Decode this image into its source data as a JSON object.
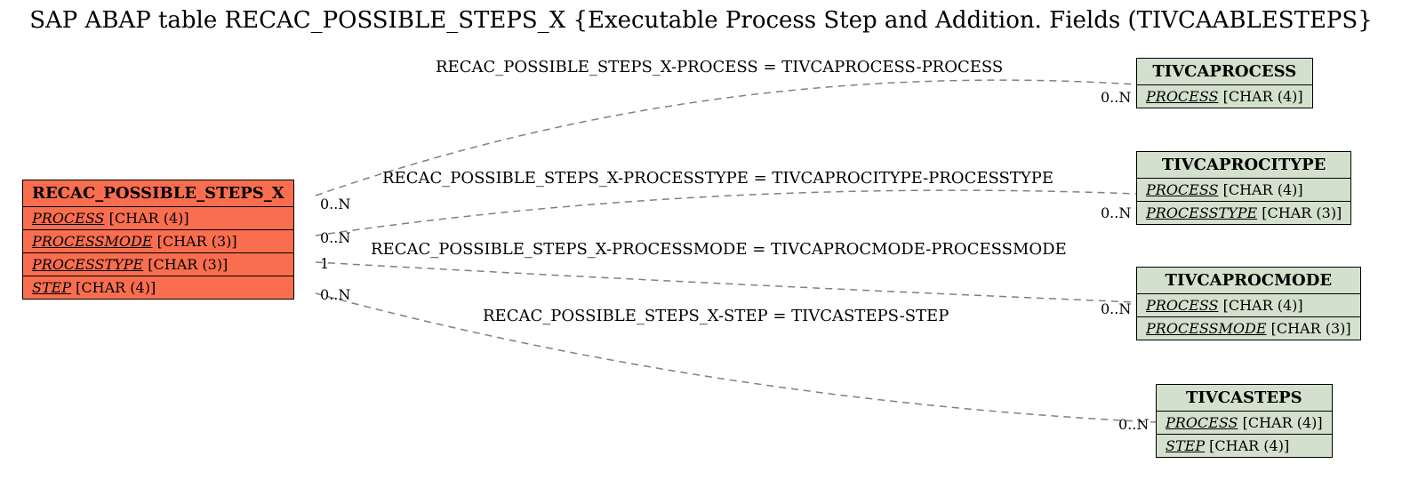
{
  "title": "SAP ABAP table RECAC_POSSIBLE_STEPS_X {Executable Process Step and Addition. Fields (TIVCAABLESTEPS}",
  "main_entity": {
    "name": "RECAC_POSSIBLE_STEPS_X",
    "fields": [
      {
        "name": "PROCESS",
        "type": "[CHAR (4)]"
      },
      {
        "name": "PROCESSMODE",
        "type": "[CHAR (3)]"
      },
      {
        "name": "PROCESSTYPE",
        "type": "[CHAR (3)]"
      },
      {
        "name": "STEP",
        "type": "[CHAR (4)]"
      }
    ]
  },
  "related_entities": [
    {
      "name": "TIVCAPROCESS",
      "fields": [
        {
          "name": "PROCESS",
          "type": "[CHAR (4)]"
        }
      ]
    },
    {
      "name": "TIVCAPROCITYPE",
      "fields": [
        {
          "name": "PROCESS",
          "type": "[CHAR (4)]"
        },
        {
          "name": "PROCESSTYPE",
          "type": "[CHAR (3)]"
        }
      ]
    },
    {
      "name": "TIVCAPROCMODE",
      "fields": [
        {
          "name": "PROCESS",
          "type": "[CHAR (4)]"
        },
        {
          "name": "PROCESSMODE",
          "type": "[CHAR (3)]"
        }
      ]
    },
    {
      "name": "TIVCASTEPS",
      "fields": [
        {
          "name": "PROCESS",
          "type": "[CHAR (4)]"
        },
        {
          "name": "STEP",
          "type": "[CHAR (4)]"
        }
      ]
    }
  ],
  "relations": [
    {
      "label": "RECAC_POSSIBLE_STEPS_X-PROCESS = TIVCAPROCESS-PROCESS",
      "left_card": "0..N",
      "right_card": "0..N"
    },
    {
      "label": "RECAC_POSSIBLE_STEPS_X-PROCESSTYPE = TIVCAPROCITYPE-PROCESSTYPE",
      "left_card": "0..N",
      "right_card": "0..N"
    },
    {
      "label": "RECAC_POSSIBLE_STEPS_X-PROCESSMODE = TIVCAPROCMODE-PROCESSMODE",
      "left_card": "1",
      "right_card": "0..N"
    },
    {
      "label": "RECAC_POSSIBLE_STEPS_X-STEP = TIVCASTEPS-STEP",
      "left_card": "0..N",
      "right_card": "0..N"
    }
  ]
}
